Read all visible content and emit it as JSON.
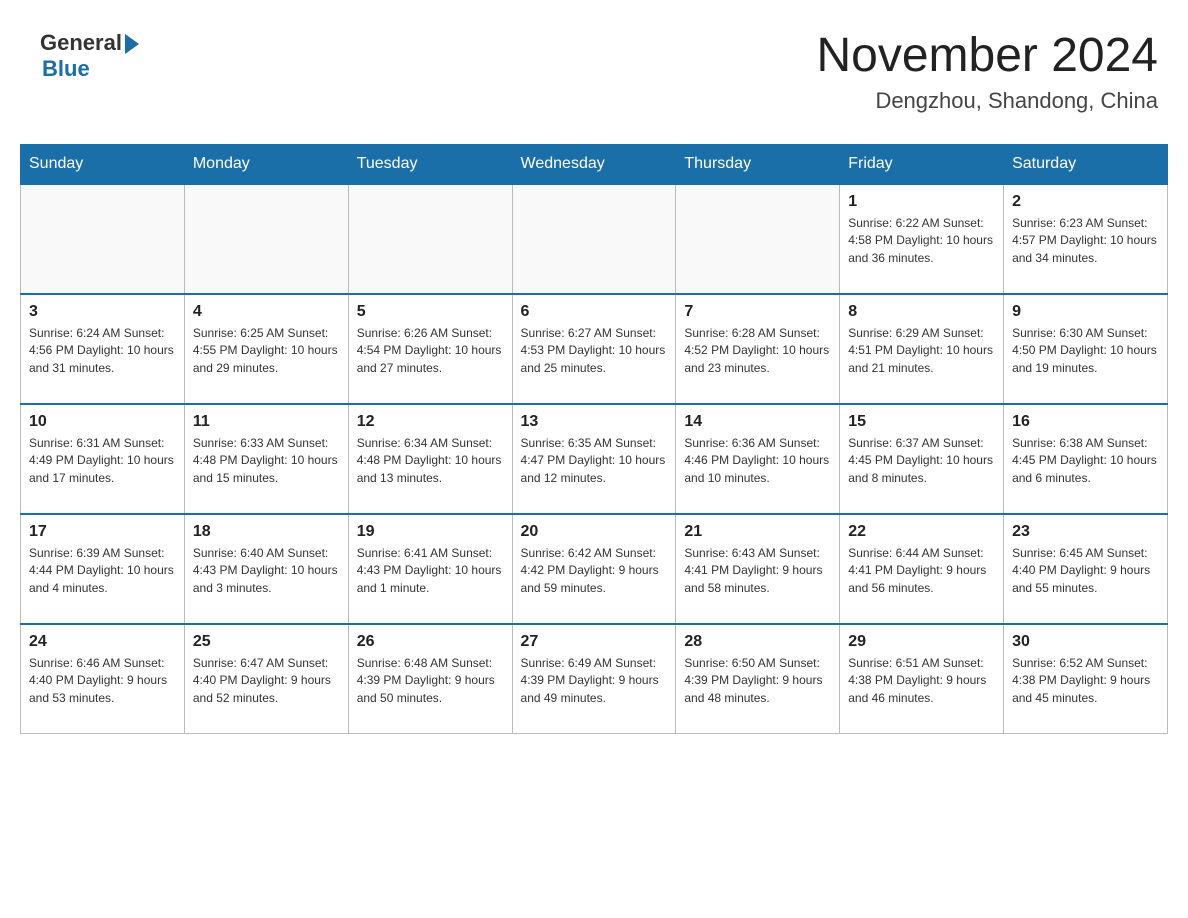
{
  "logo": {
    "general": "General",
    "blue": "Blue"
  },
  "title": "November 2024",
  "location": "Dengzhou, Shandong, China",
  "weekdays": [
    "Sunday",
    "Monday",
    "Tuesday",
    "Wednesday",
    "Thursday",
    "Friday",
    "Saturday"
  ],
  "weeks": [
    [
      {
        "day": "",
        "info": ""
      },
      {
        "day": "",
        "info": ""
      },
      {
        "day": "",
        "info": ""
      },
      {
        "day": "",
        "info": ""
      },
      {
        "day": "",
        "info": ""
      },
      {
        "day": "1",
        "info": "Sunrise: 6:22 AM\nSunset: 4:58 PM\nDaylight: 10 hours and 36 minutes."
      },
      {
        "day": "2",
        "info": "Sunrise: 6:23 AM\nSunset: 4:57 PM\nDaylight: 10 hours and 34 minutes."
      }
    ],
    [
      {
        "day": "3",
        "info": "Sunrise: 6:24 AM\nSunset: 4:56 PM\nDaylight: 10 hours and 31 minutes."
      },
      {
        "day": "4",
        "info": "Sunrise: 6:25 AM\nSunset: 4:55 PM\nDaylight: 10 hours and 29 minutes."
      },
      {
        "day": "5",
        "info": "Sunrise: 6:26 AM\nSunset: 4:54 PM\nDaylight: 10 hours and 27 minutes."
      },
      {
        "day": "6",
        "info": "Sunrise: 6:27 AM\nSunset: 4:53 PM\nDaylight: 10 hours and 25 minutes."
      },
      {
        "day": "7",
        "info": "Sunrise: 6:28 AM\nSunset: 4:52 PM\nDaylight: 10 hours and 23 minutes."
      },
      {
        "day": "8",
        "info": "Sunrise: 6:29 AM\nSunset: 4:51 PM\nDaylight: 10 hours and 21 minutes."
      },
      {
        "day": "9",
        "info": "Sunrise: 6:30 AM\nSunset: 4:50 PM\nDaylight: 10 hours and 19 minutes."
      }
    ],
    [
      {
        "day": "10",
        "info": "Sunrise: 6:31 AM\nSunset: 4:49 PM\nDaylight: 10 hours and 17 minutes."
      },
      {
        "day": "11",
        "info": "Sunrise: 6:33 AM\nSunset: 4:48 PM\nDaylight: 10 hours and 15 minutes."
      },
      {
        "day": "12",
        "info": "Sunrise: 6:34 AM\nSunset: 4:48 PM\nDaylight: 10 hours and 13 minutes."
      },
      {
        "day": "13",
        "info": "Sunrise: 6:35 AM\nSunset: 4:47 PM\nDaylight: 10 hours and 12 minutes."
      },
      {
        "day": "14",
        "info": "Sunrise: 6:36 AM\nSunset: 4:46 PM\nDaylight: 10 hours and 10 minutes."
      },
      {
        "day": "15",
        "info": "Sunrise: 6:37 AM\nSunset: 4:45 PM\nDaylight: 10 hours and 8 minutes."
      },
      {
        "day": "16",
        "info": "Sunrise: 6:38 AM\nSunset: 4:45 PM\nDaylight: 10 hours and 6 minutes."
      }
    ],
    [
      {
        "day": "17",
        "info": "Sunrise: 6:39 AM\nSunset: 4:44 PM\nDaylight: 10 hours and 4 minutes."
      },
      {
        "day": "18",
        "info": "Sunrise: 6:40 AM\nSunset: 4:43 PM\nDaylight: 10 hours and 3 minutes."
      },
      {
        "day": "19",
        "info": "Sunrise: 6:41 AM\nSunset: 4:43 PM\nDaylight: 10 hours and 1 minute."
      },
      {
        "day": "20",
        "info": "Sunrise: 6:42 AM\nSunset: 4:42 PM\nDaylight: 9 hours and 59 minutes."
      },
      {
        "day": "21",
        "info": "Sunrise: 6:43 AM\nSunset: 4:41 PM\nDaylight: 9 hours and 58 minutes."
      },
      {
        "day": "22",
        "info": "Sunrise: 6:44 AM\nSunset: 4:41 PM\nDaylight: 9 hours and 56 minutes."
      },
      {
        "day": "23",
        "info": "Sunrise: 6:45 AM\nSunset: 4:40 PM\nDaylight: 9 hours and 55 minutes."
      }
    ],
    [
      {
        "day": "24",
        "info": "Sunrise: 6:46 AM\nSunset: 4:40 PM\nDaylight: 9 hours and 53 minutes."
      },
      {
        "day": "25",
        "info": "Sunrise: 6:47 AM\nSunset: 4:40 PM\nDaylight: 9 hours and 52 minutes."
      },
      {
        "day": "26",
        "info": "Sunrise: 6:48 AM\nSunset: 4:39 PM\nDaylight: 9 hours and 50 minutes."
      },
      {
        "day": "27",
        "info": "Sunrise: 6:49 AM\nSunset: 4:39 PM\nDaylight: 9 hours and 49 minutes."
      },
      {
        "day": "28",
        "info": "Sunrise: 6:50 AM\nSunset: 4:39 PM\nDaylight: 9 hours and 48 minutes."
      },
      {
        "day": "29",
        "info": "Sunrise: 6:51 AM\nSunset: 4:38 PM\nDaylight: 9 hours and 46 minutes."
      },
      {
        "day": "30",
        "info": "Sunrise: 6:52 AM\nSunset: 4:38 PM\nDaylight: 9 hours and 45 minutes."
      }
    ]
  ]
}
